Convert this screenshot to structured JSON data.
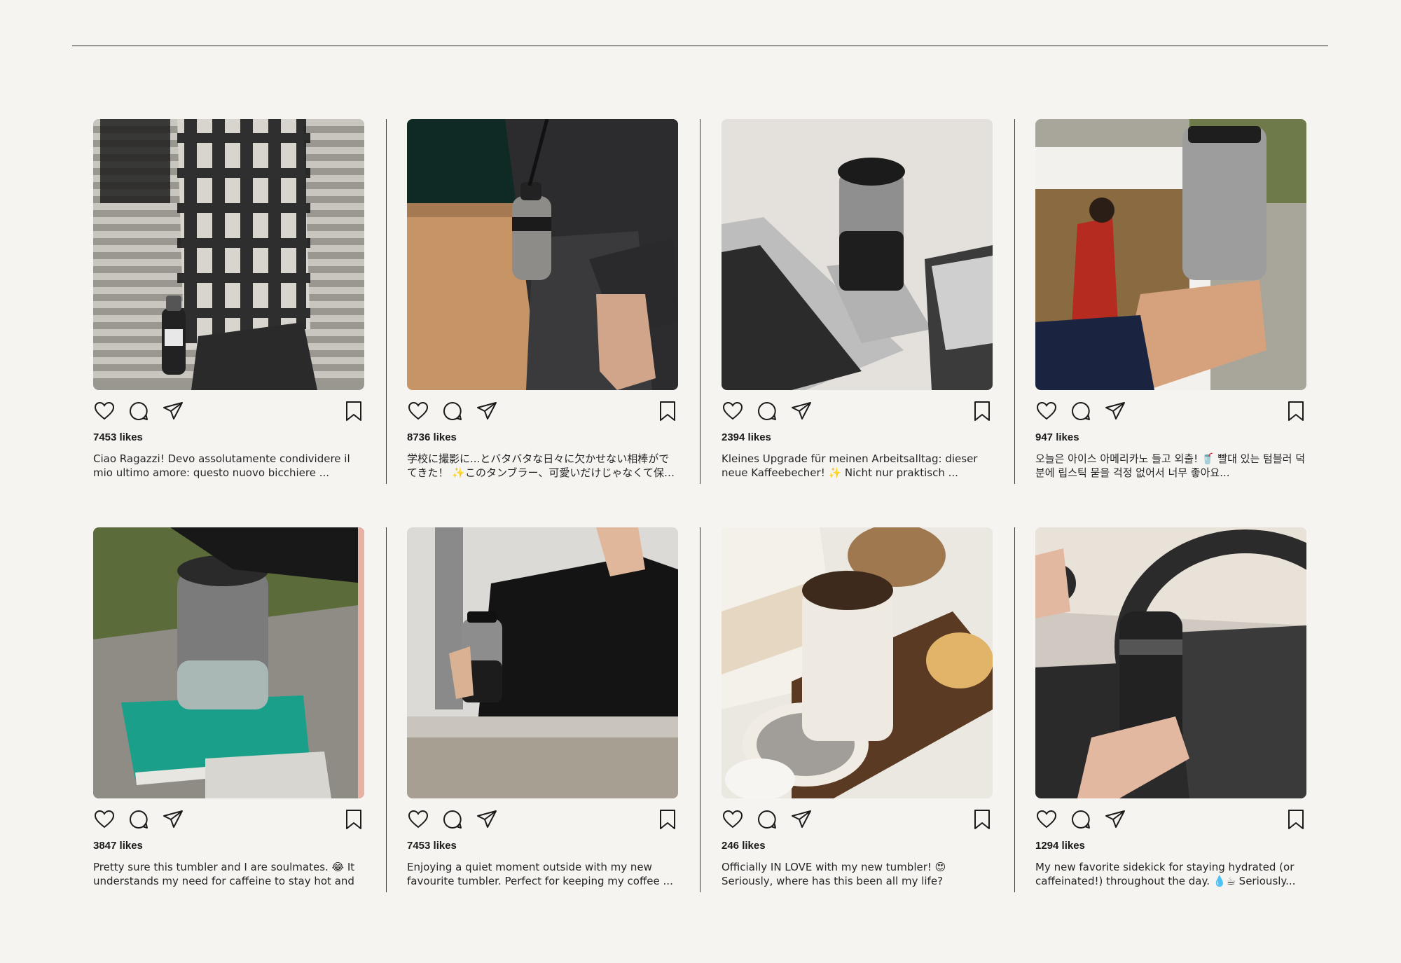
{
  "posts": [
    {
      "likes": "7453 likes",
      "caption": "Ciao Ragazzi!  Devo assolutamente condividere il mio ultimo amore: questo nuovo bicchiere ...",
      "photo": "plaid-shirt-holding-tumbler"
    },
    {
      "likes": "8736 likes",
      "caption": "学校に撮影に...とバタバタな日々に欠かせない相棒がでてきた！ ✨このタンブラー、可愛いだけじゃなくて保温...",
      "photo": "tumbler-on-strap-skirt"
    },
    {
      "likes": "2394 likes",
      "caption": "Kleines Upgrade für meinen Arbeitsalltag: dieser neue Kaffeebecher! ✨ Nicht nur praktisch ...",
      "photo": "tumbler-next-to-laptop"
    },
    {
      "likes": "947 likes",
      "caption": "오늘은 아이스 아메리카노 들고 외출! 🥤 빨대 있는 텀블러 덕분에 립스틱 묻을 걱정 없어서 너무 좋아요...",
      "photo": "tumbler-with-marni-magazine"
    },
    {
      "likes": "3847 likes",
      "caption": "Pretty sure this tumbler and I are soulmates. 😂 It understands my need for caffeine to stay hot and",
      "photo": "tumbler-on-green-book"
    },
    {
      "likes": "7453 likes",
      "caption": "Enjoying a quiet moment outside with my new favourite tumbler. Perfect for keeping my coffee ...",
      "photo": "woman-in-black-holding-tumbler"
    },
    {
      "likes": "246 likes",
      "caption": "Officially IN LOVE with my new tumbler! 😍 Seriously, where has this been all my life?",
      "photo": "cream-tumbler-with-pastry"
    },
    {
      "likes": "1294 likes",
      "caption": "My new favorite sidekick for staying hydrated (or caffeinated!) throughout the day. 💧☕ Seriously...",
      "photo": "tumbler-in-car"
    }
  ],
  "icons": {
    "like": "heart-icon",
    "comment": "comment-icon",
    "share": "share-icon",
    "save": "bookmark-icon"
  },
  "colors": {
    "background": "#f5f4f1",
    "text": "#1b1b1b",
    "rule": "#2a2a2a"
  }
}
